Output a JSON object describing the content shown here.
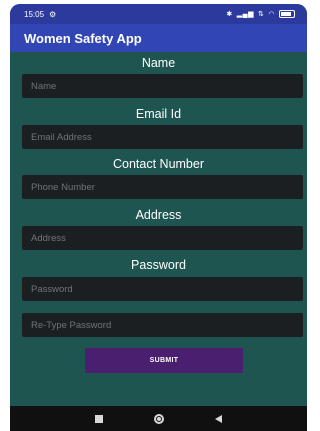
{
  "status_bar": {
    "time": "15:05",
    "left_icon": "settings-icon",
    "right_icons": [
      "bluetooth-icon",
      "signal-icon",
      "signal-icon",
      "data-icon",
      "wifi-icon",
      "battery-icon"
    ],
    "background": "#2b3a9c"
  },
  "app_bar": {
    "title": "Women Safety App",
    "background": "#3245b4"
  },
  "form": {
    "background": "#1f5551",
    "name": {
      "label": "Name",
      "placeholder": "Name"
    },
    "email": {
      "label": "Email Id",
      "placeholder": "Email Address"
    },
    "contact": {
      "label": "Contact Number",
      "placeholder": "Phone Number"
    },
    "address": {
      "label": "Address",
      "placeholder": "Address"
    },
    "password": {
      "label": "Password",
      "placeholder": "Password"
    },
    "retype_password": {
      "placeholder": "Re-Type Password"
    },
    "submit_label": "SUBMIT",
    "submit_color": "#4a1f70"
  },
  "nav_bar": {
    "icons": [
      "recents-icon",
      "home-icon",
      "back-icon"
    ]
  }
}
